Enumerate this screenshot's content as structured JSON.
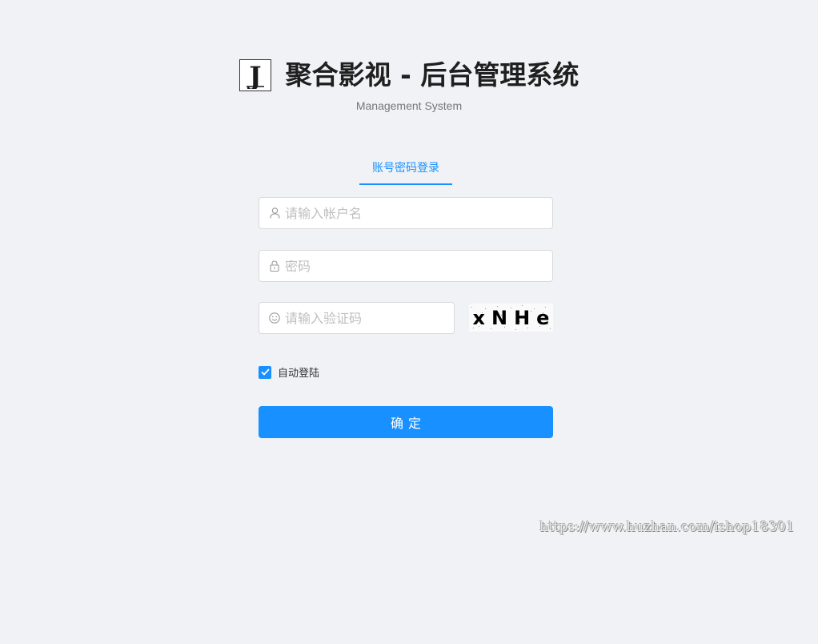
{
  "header": {
    "logo_letter": "J",
    "title": "聚合影视 - 后台管理系统",
    "subtitle": "Management System"
  },
  "tabs": [
    {
      "label": "账号密码登录",
      "active": true
    }
  ],
  "form": {
    "username_placeholder": "请输入帐户名",
    "password_placeholder": "密码",
    "captcha_placeholder": "请输入验证码",
    "captcha_text": "xNHe",
    "remember_label": "自动登陆",
    "remember_checked": true,
    "submit_label": "确定"
  },
  "icons": {
    "username": "user-icon",
    "password": "lock-icon",
    "captcha": "smile-icon",
    "checkbox": "check-icon"
  },
  "colors": {
    "primary": "#1890ff",
    "background": "#f0f2f5"
  },
  "watermark": "https://www.huzhan.com/ishop18301"
}
